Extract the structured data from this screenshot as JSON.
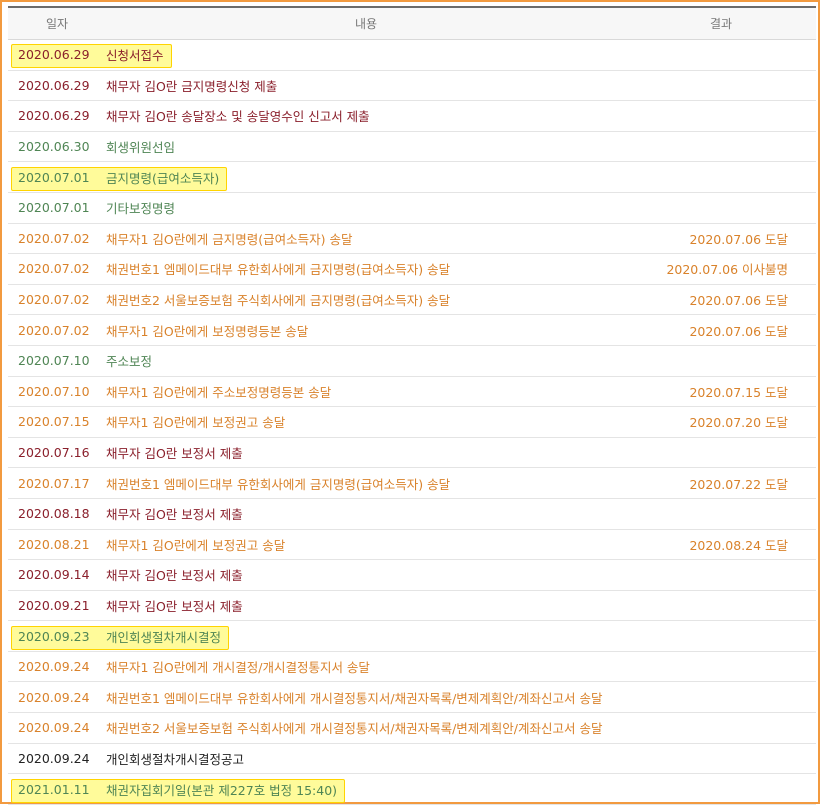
{
  "table": {
    "headers": {
      "date": "일자",
      "content": "내용",
      "result": "결과"
    },
    "rows": [
      {
        "date": "2020.06.29",
        "content": "신청서접수",
        "result": "",
        "category": "submit",
        "highlight": true
      },
      {
        "date": "2020.06.29",
        "content": "채무자 김O란 금지명령신청 제출",
        "result": "",
        "category": "submit",
        "highlight": false
      },
      {
        "date": "2020.06.29",
        "content": "채무자 김O란 송달장소 및 송달영수인 신고서 제출",
        "result": "",
        "category": "submit",
        "highlight": false
      },
      {
        "date": "2020.06.30",
        "content": "회생위원선임",
        "result": "",
        "category": "decision",
        "highlight": false
      },
      {
        "date": "2020.07.01",
        "content": "금지명령(급여소득자)",
        "result": "",
        "category": "decision",
        "highlight": true
      },
      {
        "date": "2020.07.01",
        "content": "기타보정명령",
        "result": "",
        "category": "decision",
        "highlight": false
      },
      {
        "date": "2020.07.02",
        "content": "채무자1 김O란에게 금지명령(급여소득자) 송달",
        "result": "2020.07.06 도달",
        "category": "delivery",
        "highlight": false
      },
      {
        "date": "2020.07.02",
        "content": "채권번호1 엠메이드대부 유한회사에게 금지명령(급여소득자) 송달",
        "result": "2020.07.06 이사불명",
        "category": "delivery",
        "highlight": false
      },
      {
        "date": "2020.07.02",
        "content": "채권번호2 서울보증보험 주식회사에게 금지명령(급여소득자) 송달",
        "result": "2020.07.06 도달",
        "category": "delivery",
        "highlight": false
      },
      {
        "date": "2020.07.02",
        "content": "채무자1 김O란에게 보정명령등본 송달",
        "result": "2020.07.06 도달",
        "category": "delivery",
        "highlight": false
      },
      {
        "date": "2020.07.10",
        "content": "주소보정",
        "result": "",
        "category": "decision",
        "highlight": false
      },
      {
        "date": "2020.07.10",
        "content": "채무자1 김O란에게 주소보정명령등본 송달",
        "result": "2020.07.15 도달",
        "category": "delivery",
        "highlight": false
      },
      {
        "date": "2020.07.15",
        "content": "채무자1 김O란에게 보정권고 송달",
        "result": "2020.07.20 도달",
        "category": "delivery",
        "highlight": false
      },
      {
        "date": "2020.07.16",
        "content": "채무자 김O란 보정서 제출",
        "result": "",
        "category": "submit",
        "highlight": false
      },
      {
        "date": "2020.07.17",
        "content": "채권번호1 엠메이드대부 유한회사에게 금지명령(급여소득자) 송달",
        "result": "2020.07.22 도달",
        "category": "delivery",
        "highlight": false
      },
      {
        "date": "2020.08.18",
        "content": "채무자 김O란 보정서 제출",
        "result": "",
        "category": "submit",
        "highlight": false
      },
      {
        "date": "2020.08.21",
        "content": "채무자1 김O란에게 보정권고 송달",
        "result": "2020.08.24 도달",
        "category": "delivery",
        "highlight": false
      },
      {
        "date": "2020.09.14",
        "content": "채무자 김O란 보정서 제출",
        "result": "",
        "category": "submit",
        "highlight": false
      },
      {
        "date": "2020.09.21",
        "content": "채무자 김O란 보정서 제출",
        "result": "",
        "category": "submit",
        "highlight": false
      },
      {
        "date": "2020.09.23",
        "content": "개인회생절차개시결정",
        "result": "",
        "category": "decision",
        "highlight": true
      },
      {
        "date": "2020.09.24",
        "content": "채무자1 김O란에게 개시결정/개시결정통지서 송달",
        "result": "",
        "category": "delivery",
        "highlight": false
      },
      {
        "date": "2020.09.24",
        "content": "채권번호1 엠메이드대부 유한회사에게 개시결정통지서/채권자목록/변제계획안/계좌신고서 송달",
        "result": "",
        "category": "delivery",
        "highlight": false
      },
      {
        "date": "2020.09.24",
        "content": "채권번호2 서울보증보험 주식회사에게 개시결정통지서/채권자목록/변제계획안/계좌신고서 송달",
        "result": "",
        "category": "delivery",
        "highlight": false
      },
      {
        "date": "2020.09.24",
        "content": "개인회생절차개시결정공고",
        "result": "",
        "category": "notice",
        "highlight": false
      },
      {
        "date": "2021.01.11",
        "content": "채권자집회기일(본관 제227호 법정 15:40)",
        "result": "",
        "category": "decision",
        "highlight": true
      }
    ]
  },
  "colors": {
    "submit": "#8a1f2b",
    "decision": "#4f8554",
    "delivery": "#d9822b",
    "notice": "#222222",
    "highlight_fill": "#fffb9a",
    "highlight_border": "#ffd400",
    "frame_border": "#f29a3f"
  }
}
